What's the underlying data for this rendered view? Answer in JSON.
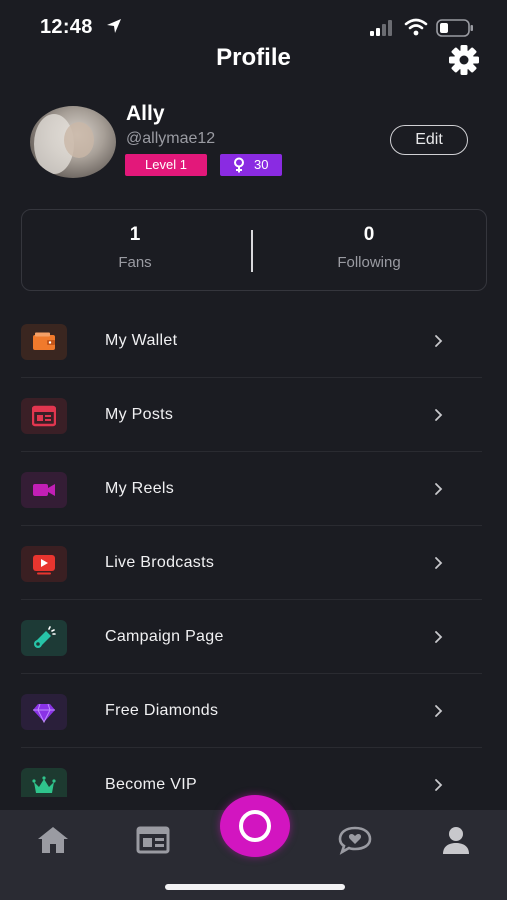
{
  "status_bar": {
    "time": "12:48",
    "icons": [
      "location-arrow-icon",
      "cellular-signal-icon",
      "wifi-icon",
      "battery-icon"
    ]
  },
  "header": {
    "title": "Profile",
    "settings_icon": "gear-icon"
  },
  "profile": {
    "name": "Ally",
    "handle": "@allymae12",
    "level": "Level 1",
    "points": "30",
    "points_icon": "female-symbol-icon",
    "edit_label": "Edit"
  },
  "stats": {
    "fans": {
      "value": "1",
      "label": "Fans"
    },
    "following": {
      "value": "0",
      "label": "Following"
    }
  },
  "menu": {
    "items": [
      {
        "label": "My Wallet",
        "icon": "wallet-icon",
        "color": "#f07a2c",
        "bg": "#3a2620"
      },
      {
        "label": "My Posts",
        "icon": "posts-card-icon",
        "color": "#e2364f",
        "bg": "#3a1f26"
      },
      {
        "label": "My Reels",
        "icon": "video-camera-icon",
        "color": "#c21fb5",
        "bg": "#341d35"
      },
      {
        "label": "Live Brodcasts",
        "icon": "play-screen-icon",
        "color": "#e8352f",
        "bg": "#3a1f22"
      },
      {
        "label": "Campaign Page",
        "icon": "megaphone-icon",
        "color": "#27c4a8",
        "bg": "#1d3a36"
      },
      {
        "label": "Free Diamonds",
        "icon": "diamond-icon",
        "color": "#8a33e6",
        "bg": "#2a1f3a"
      },
      {
        "label": "Become VIP",
        "icon": "crown-icon",
        "color": "#2fc48c",
        "bg": "#1d3a30"
      }
    ]
  },
  "tab_bar": {
    "tabs": [
      "home-icon",
      "feed-card-icon",
      "record-button",
      "chat-heart-icon",
      "profile-person-icon"
    ],
    "accent": "#d215c0"
  },
  "colors": {
    "background": "#1b1c22",
    "tab_bar": "#2a2b33",
    "level_badge": "#e3187a",
    "points_badge": "#8a2be2"
  }
}
